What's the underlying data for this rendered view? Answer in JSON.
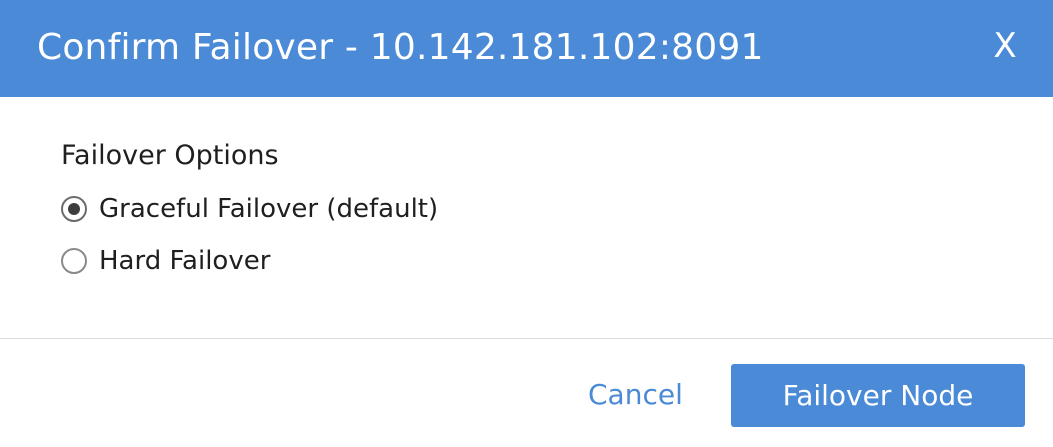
{
  "dialog": {
    "title": "Confirm Failover - 10.142.181.102:8091",
    "close_label": "X"
  },
  "options": {
    "heading": "Failover Options",
    "items": [
      {
        "label": "Graceful Failover (default)",
        "selected": true
      },
      {
        "label": "Hard Failover",
        "selected": false
      }
    ]
  },
  "footer": {
    "cancel_label": "Cancel",
    "confirm_label": "Failover Node"
  },
  "colors": {
    "accent": "#4a8ad6",
    "header_text": "#ffffff",
    "body_text": "#1f1f1f"
  }
}
